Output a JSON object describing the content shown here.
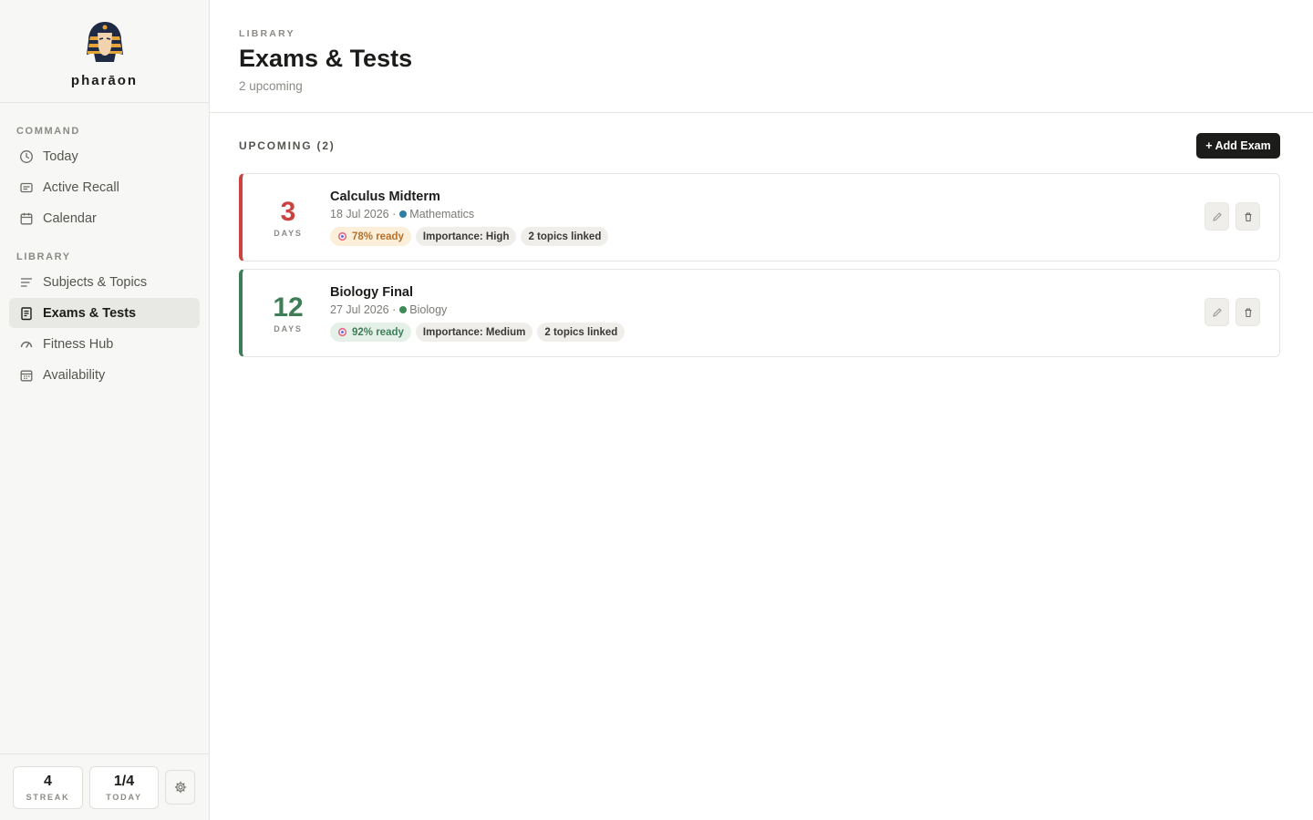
{
  "brand": {
    "name": "pharāon",
    "logo_icon": "pharaoh-logo-icon"
  },
  "nav": {
    "sections": [
      {
        "label": "COMMAND",
        "items": [
          {
            "label": "Today",
            "icon": "clock-icon"
          },
          {
            "label": "Active Recall",
            "icon": "card-icon"
          },
          {
            "label": "Calendar",
            "icon": "calendar-icon"
          }
        ]
      },
      {
        "label": "LIBRARY",
        "items": [
          {
            "label": "Subjects & Topics",
            "icon": "lines-icon"
          },
          {
            "label": "Exams & Tests",
            "icon": "clipboard-icon",
            "active": true
          },
          {
            "label": "Fitness Hub",
            "icon": "gauge-icon"
          },
          {
            "label": "Availability",
            "icon": "calendar-grid-icon"
          }
        ]
      }
    ]
  },
  "footer": {
    "streak": {
      "value": "4",
      "label": "STREAK"
    },
    "today": {
      "value": "1/4",
      "label": "TODAY"
    },
    "settings_icon": "gear-icon"
  },
  "header": {
    "eyebrow": "LIBRARY",
    "title": "Exams & Tests",
    "subtitle": "2 upcoming"
  },
  "upcoming": {
    "label": "UPCOMING (2)",
    "add_label": "+ Add Exam",
    "exams": [
      {
        "days": "3",
        "days_unit": "DAYS",
        "title": "Calculus Midterm",
        "date": "18 Jul 2026 ·",
        "subject": "Mathematics",
        "subject_color": "#2f7fa3",
        "accent": "#c9443f",
        "ready": "78% ready",
        "ready_bg": "#fbefd9",
        "ready_color": "#b8702a",
        "importance": "Importance: High",
        "topics": "2 topics linked"
      },
      {
        "days": "12",
        "days_unit": "DAYS",
        "title": "Biology Final",
        "date": "27 Jul 2026 ·",
        "subject": "Biology",
        "subject_color": "#3f8a57",
        "accent": "#3f7d58",
        "ready": "92% ready",
        "ready_bg": "#e5f1e8",
        "ready_color": "#3f7d58",
        "importance": "Importance: Medium",
        "topics": "2 topics linked"
      }
    ]
  }
}
